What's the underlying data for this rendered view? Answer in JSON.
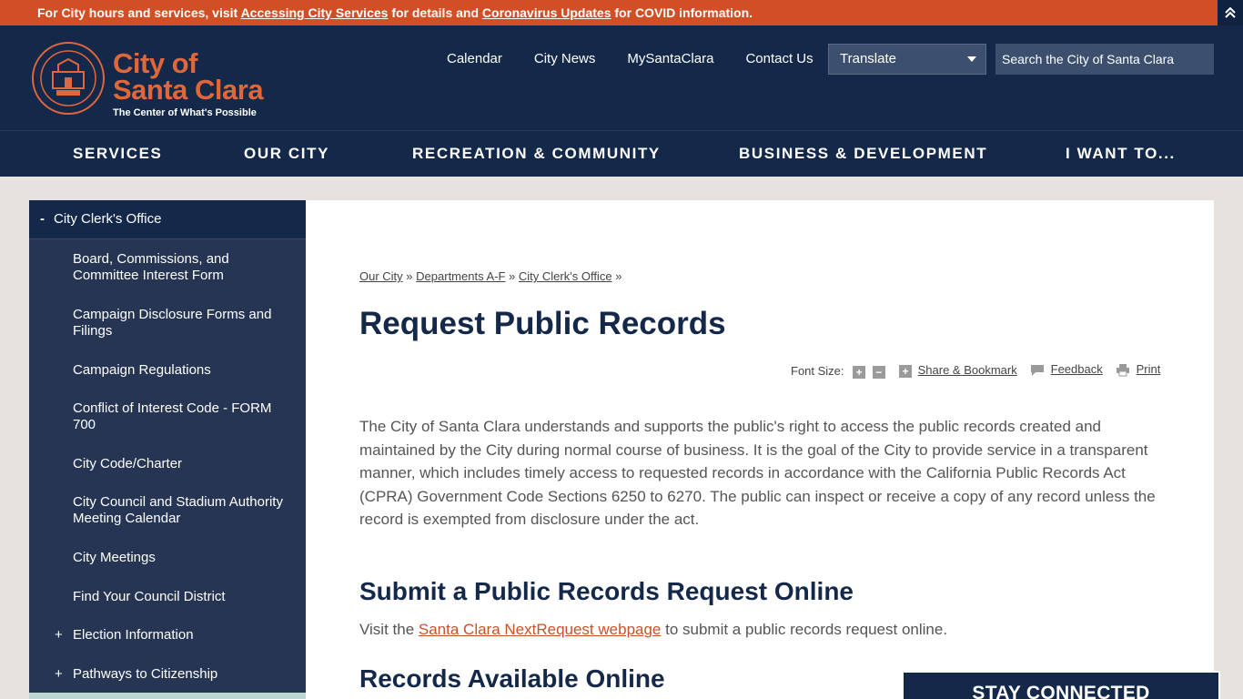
{
  "alert": {
    "text_1": "For City hours and services, visit ",
    "link_1": "Accessing City Services",
    "text_2": " for details and ",
    "link_2": "Coronavirus Updates",
    "text_3": " for COVID information."
  },
  "header": {
    "logo_line1": "City of",
    "logo_line2": "Santa Clara",
    "tagline": "The Center of What's Possible",
    "top_links": [
      "Calendar",
      "City News",
      "MySantaClara",
      "Contact Us"
    ],
    "translate_label": "Translate",
    "search_placeholder": "Search the City of Santa Clara"
  },
  "main_nav": [
    "SERVICES",
    "OUR CITY",
    "RECREATION & COMMUNITY",
    "BUSINESS & DEVELOPMENT",
    "I WANT TO..."
  ],
  "sidebar": {
    "heading": "City Clerk's Office",
    "items": [
      {
        "label": "Board, Commissions, and Committee Interest Form"
      },
      {
        "label": "Campaign Disclosure Forms and Filings"
      },
      {
        "label": "Campaign Regulations"
      },
      {
        "label": "Conflict of Interest Code - FORM 700"
      },
      {
        "label": "City Code/Charter"
      },
      {
        "label": "City Council and Stadium Authority Meeting Calendar"
      },
      {
        "label": "City Meetings"
      },
      {
        "label": "Find Your Council District"
      },
      {
        "label": "Election Information"
      },
      {
        "label": "Pathways to Citizenship"
      }
    ]
  },
  "breadcrumb": {
    "items": [
      "Our City",
      "Departments A-F",
      "City Clerk's Office"
    ],
    "separator": "»"
  },
  "page": {
    "title": "Request Public Records",
    "tools": {
      "font_size_label": "Font Size:",
      "share_label": "Share & Bookmark",
      "feedback_label": "Feedback",
      "print_label": "Print"
    },
    "intro": "The City of Santa Clara understands and supports the public's right to access the public records created and maintained by the City during normal course of business. It is the goal of the City to provide service in a transparent manner, which includes timely access to requested records in accordance with the California Public Records Act (CPRA) Government Code Sections 6250 to 6270. The public can inspect or receive a copy of any record unless the record is exempted from disclosure under the act.",
    "section1_title": "Submit a Public Records Request Online",
    "visit_prefix": "Visit the ",
    "visit_link": "Santa Clara NextRequest webpage",
    "visit_suffix": " to submit a public records request online.",
    "section2_title": "Records Available Online"
  },
  "stay_connected": "STAY CONNECTED"
}
